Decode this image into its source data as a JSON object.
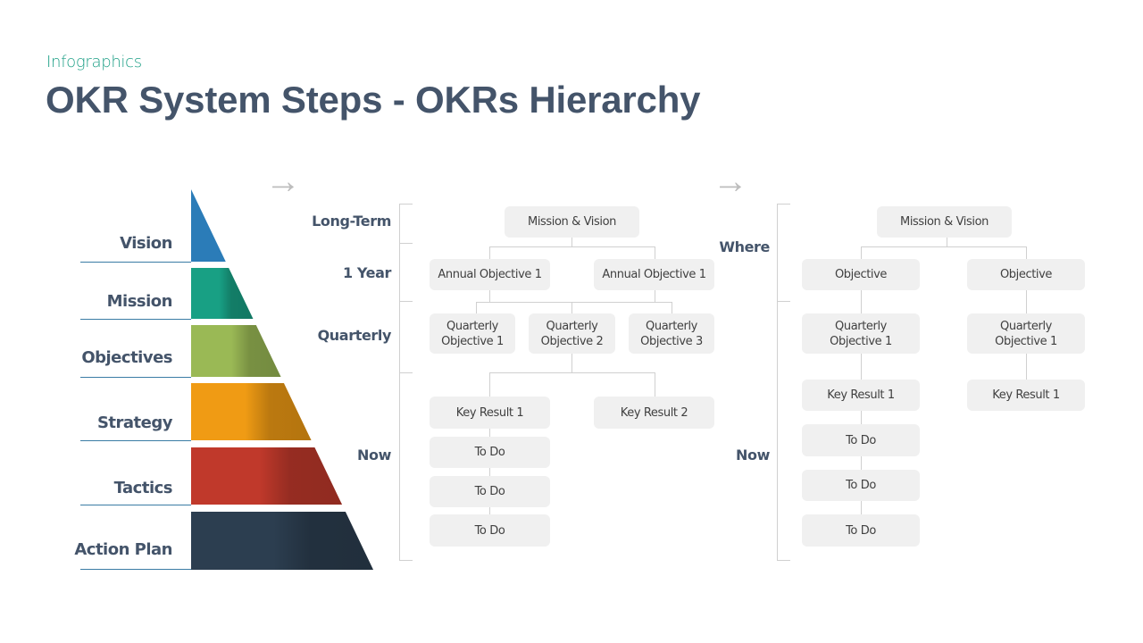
{
  "header": {
    "subtitle": "Infographics",
    "title": "OKR System Steps - OKRs Hierarchy"
  },
  "pyramid": {
    "levels": [
      {
        "label": "Vision",
        "color": "#2b7cb8"
      },
      {
        "label": "Mission",
        "color": "#18a084"
      },
      {
        "label": "Objectives",
        "color": "#9ab955"
      },
      {
        "label": "Strategy",
        "color": "#f09b14"
      },
      {
        "label": "Tactics",
        "color": "#c0392b"
      },
      {
        "label": "Action Plan",
        "color": "#2c3e50"
      }
    ]
  },
  "arrows": {
    "glyph": "→"
  },
  "chart1": {
    "timeline": [
      "Long-Term",
      "1 Year",
      "Quarterly",
      "Now"
    ],
    "root": "Mission & Vision",
    "annual": [
      "Annual Objective 1",
      "Annual Objective 1"
    ],
    "quarterly": [
      "Quarterly\nObjective 1",
      "Quarterly\nObjective 2",
      "Quarterly\nObjective 3"
    ],
    "key_results": [
      "Key Result 1",
      "Key Result 2"
    ],
    "todos": [
      "To Do",
      "To Do",
      "To Do"
    ]
  },
  "chart2": {
    "timeline": [
      "Where",
      "Now"
    ],
    "root": "Mission & Vision",
    "objectives": [
      "Objective",
      "Objective"
    ],
    "quarterly": [
      "Quarterly\nObjective 1",
      "Quarterly\nObjective 1"
    ],
    "key_results": [
      "Key Result 1",
      "Key Result 1"
    ],
    "todos": [
      "To Do",
      "To Do",
      "To Do"
    ]
  }
}
